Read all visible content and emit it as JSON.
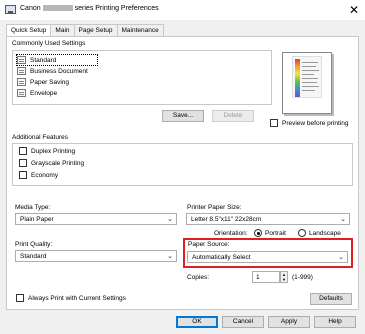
{
  "window": {
    "title_prefix": "Canon",
    "title_suffix": "series Printing Preferences",
    "close_symbol": "✕"
  },
  "tabs": [
    "Quick Setup",
    "Main",
    "Page Setup",
    "Maintenance"
  ],
  "commonly_used": {
    "label": "Commonly Used Settings",
    "items": [
      "Standard",
      "Business Document",
      "Paper Saving",
      "Envelope"
    ],
    "selected_index": 0,
    "save_button": "Save...",
    "delete_button": "Delete"
  },
  "preview": {
    "label": "Preview before printing",
    "checked": false
  },
  "additional_features": {
    "label": "Additional Features",
    "items": [
      {
        "label": "Duplex Printing",
        "checked": false
      },
      {
        "label": "Grayscale Printing",
        "checked": false
      },
      {
        "label": "Economy",
        "checked": false
      }
    ]
  },
  "media_type": {
    "label": "Media Type:",
    "value": "Plain Paper"
  },
  "printer_paper_size": {
    "label": "Printer Paper Size:",
    "value": "Letter 8.5\"x11\" 22x28cm"
  },
  "orientation": {
    "label": "Orientation:",
    "portrait": "Portrait",
    "landscape": "Landscape",
    "selected": "Portrait"
  },
  "print_quality": {
    "label": "Print Quality:",
    "value": "Standard"
  },
  "paper_source": {
    "label": "Paper Source:",
    "value": "Automatically Select",
    "highlight_color": "#e0201e"
  },
  "copies": {
    "label": "Copies:",
    "value": "1",
    "range": "(1-999)"
  },
  "always_print": {
    "label": "Always Print with Current Settings",
    "checked": false
  },
  "buttons": {
    "defaults": "Defaults",
    "ok": "OK",
    "cancel": "Cancel",
    "apply": "Apply",
    "help": "Help"
  },
  "icons": {
    "chevron": "⌄",
    "spin_up": "▲",
    "spin_down": "▼"
  }
}
